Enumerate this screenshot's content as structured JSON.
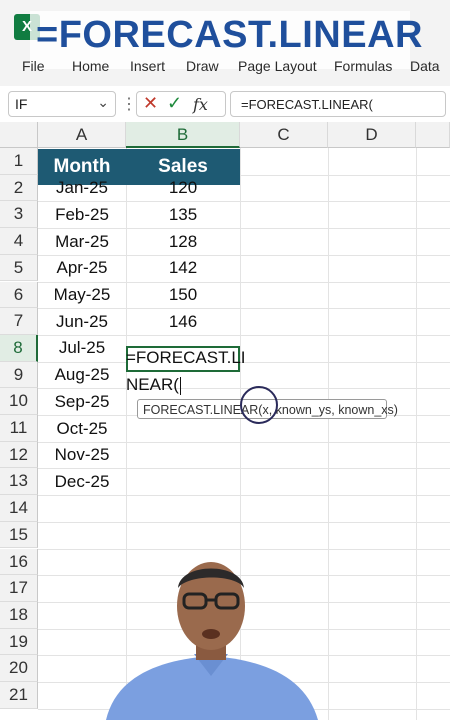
{
  "ribbon": {
    "app_icon_letter": "X",
    "headline": "=FORECAST.LINEAR",
    "menu": [
      "File",
      "Home",
      "Insert",
      "Draw",
      "Page Layout",
      "Formulas",
      "Data"
    ]
  },
  "formula_bar": {
    "name_box": "IF",
    "fx_label": "fx",
    "formula": "=FORECAST.LINEAR("
  },
  "grid": {
    "columns": [
      "A",
      "B",
      "C",
      "D"
    ],
    "rows": [
      "1",
      "2",
      "3",
      "4",
      "5",
      "6",
      "7",
      "8",
      "9",
      "10",
      "11",
      "12",
      "13",
      "14",
      "15",
      "16",
      "17",
      "18",
      "19",
      "20",
      "21"
    ],
    "header": {
      "month": "Month",
      "sales": "Sales"
    },
    "data": [
      {
        "month": "Jan-25",
        "sales": "120"
      },
      {
        "month": "Feb-25",
        "sales": "135"
      },
      {
        "month": "Mar-25",
        "sales": "128"
      },
      {
        "month": "Apr-25",
        "sales": "142"
      },
      {
        "month": "May-25",
        "sales": "150"
      },
      {
        "month": "Jun-25",
        "sales": "146"
      },
      {
        "month": "Jul-25",
        "sales": ""
      },
      {
        "month": "Aug-25",
        "sales": ""
      },
      {
        "month": "Sep-25",
        "sales": ""
      },
      {
        "month": "Oct-25",
        "sales": ""
      },
      {
        "month": "Nov-25",
        "sales": ""
      },
      {
        "month": "Dec-25",
        "sales": ""
      }
    ],
    "editing_line1": "=FORECAST.LI",
    "editing_line2": "NEAR(",
    "tooltip": "FORECAST.LINEAR(x, known_ys, known_xs)"
  },
  "colors": {
    "header_fill": "#1e5a73",
    "selection_green": "#1e6b38",
    "headline_blue": "#1f4f9c"
  }
}
